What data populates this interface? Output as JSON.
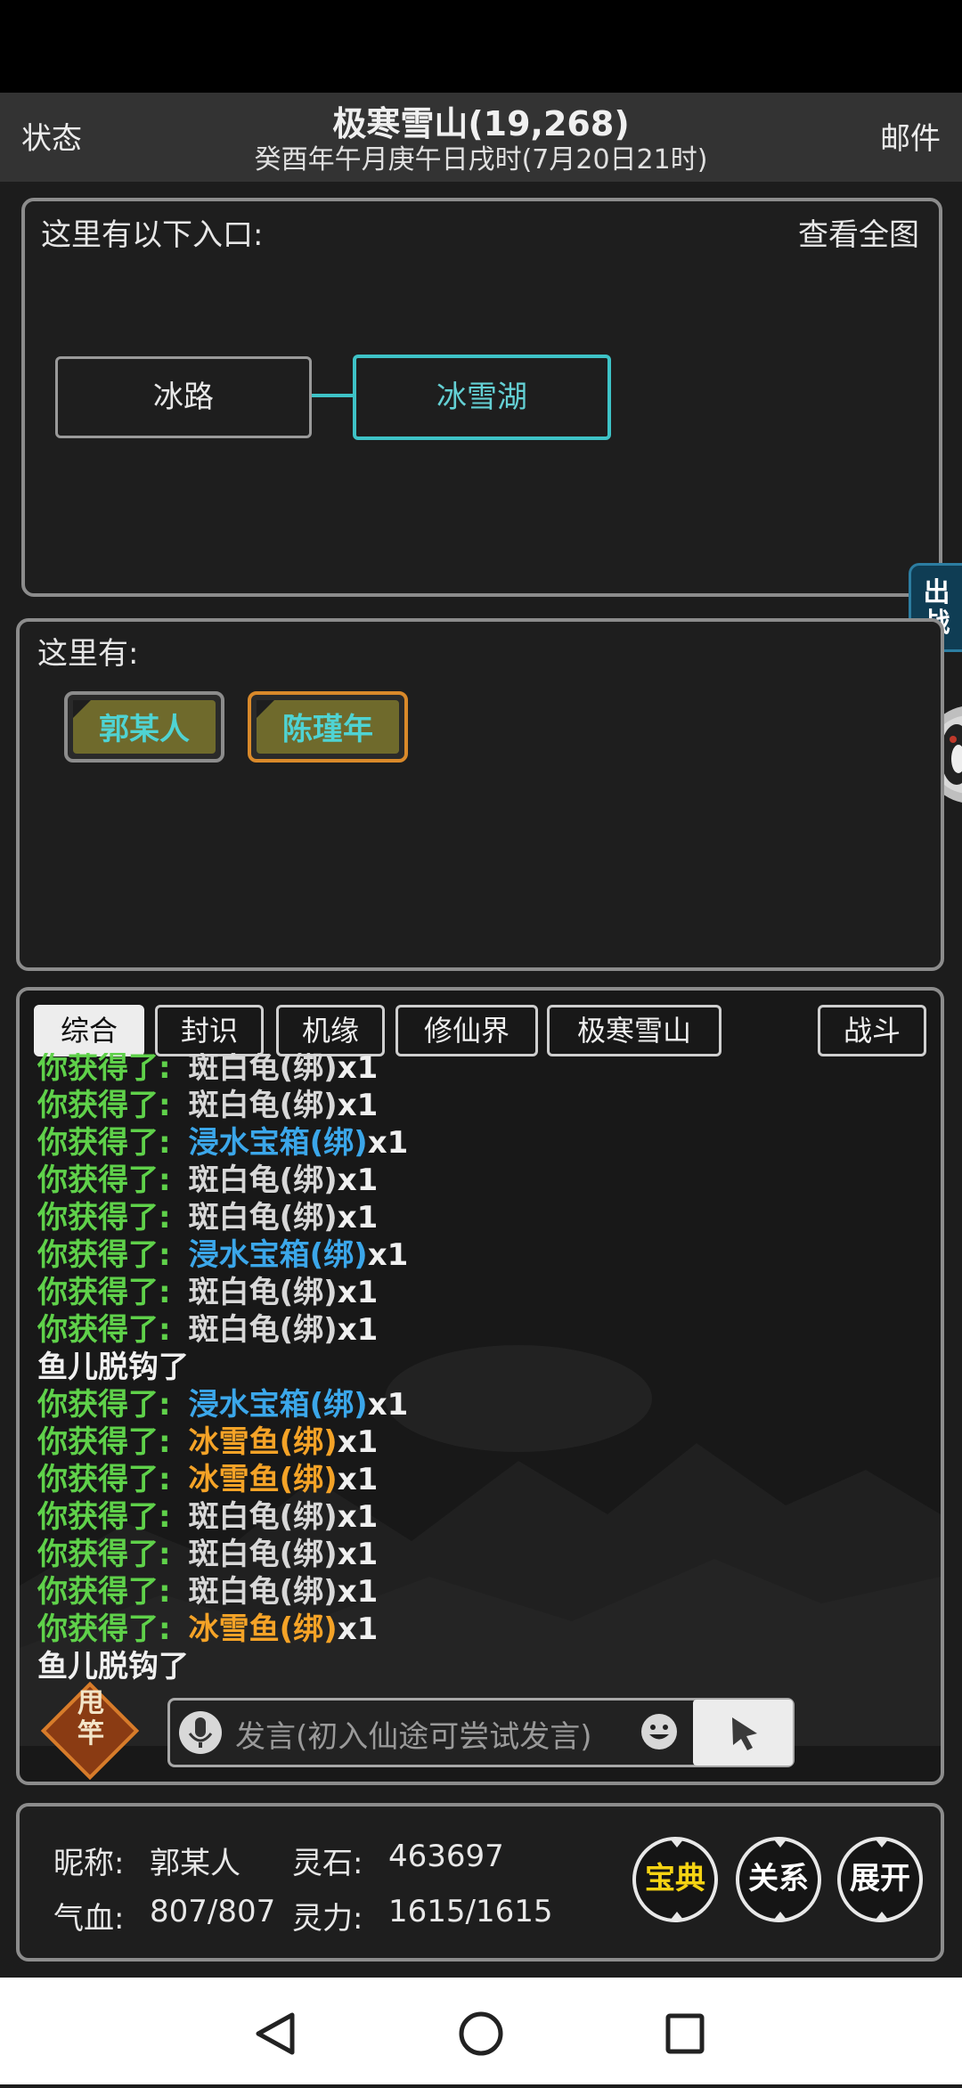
{
  "header": {
    "left_label": "状态",
    "right_label": "邮件",
    "title": "极寒雪山(19,268)",
    "subtitle": "癸酉年午月庚午日戌时(7月20日21时)"
  },
  "entrances": {
    "title": "这里有以下入口:",
    "map_link": "查看全图",
    "rooms": [
      "冰路",
      "冰雪湖"
    ]
  },
  "side_tab": {
    "label_top": "出",
    "label_bottom": "战"
  },
  "here": {
    "title": "这里有:",
    "npcs": [
      "郭某人",
      "陈瑾年"
    ]
  },
  "chat": {
    "tabs": [
      "综合",
      "封识",
      "机缘",
      "修仙界",
      "极寒雪山",
      "战斗"
    ],
    "active_tab": "综合",
    "log": [
      {
        "label": "你获得了:",
        "item": "斑白龟(绑)",
        "qty": "x1",
        "color": "#d8d8d8"
      },
      {
        "label": "你获得了:",
        "item": "斑白龟(绑)",
        "qty": "x1",
        "color": "#d8d8d8"
      },
      {
        "label": "你获得了:",
        "item": "浸水宝箱(绑)",
        "qty": "x1",
        "color": "#3ba7ea"
      },
      {
        "label": "你获得了:",
        "item": "斑白龟(绑)",
        "qty": "x1",
        "color": "#d8d8d8"
      },
      {
        "label": "你获得了:",
        "item": "斑白龟(绑)",
        "qty": "x1",
        "color": "#d8d8d8"
      },
      {
        "label": "你获得了:",
        "item": "浸水宝箱(绑)",
        "qty": "x1",
        "color": "#3ba7ea"
      },
      {
        "label": "你获得了:",
        "item": "斑白龟(绑)",
        "qty": "x1",
        "color": "#d8d8d8"
      },
      {
        "label": "你获得了:",
        "item": "斑白龟(绑)",
        "qty": "x1",
        "color": "#d8d8d8"
      },
      {
        "system": "鱼儿脱钩了"
      },
      {
        "label": "你获得了:",
        "item": "浸水宝箱(绑)",
        "qty": "x1",
        "color": "#3ba7ea"
      },
      {
        "label": "你获得了:",
        "item": "冰雪鱼(绑)",
        "qty": "x1",
        "color": "#f5a327"
      },
      {
        "label": "你获得了:",
        "item": "冰雪鱼(绑)",
        "qty": "x1",
        "color": "#f5a327"
      },
      {
        "label": "你获得了:",
        "item": "斑白龟(绑)",
        "qty": "x1",
        "color": "#d8d8d8"
      },
      {
        "label": "你获得了:",
        "item": "斑白龟(绑)",
        "qty": "x1",
        "color": "#d8d8d8"
      },
      {
        "label": "你获得了:",
        "item": "斑白龟(绑)",
        "qty": "x1",
        "color": "#d8d8d8"
      },
      {
        "label": "你获得了:",
        "item": "冰雪鱼(绑)",
        "qty": "x1",
        "color": "#f5a327"
      },
      {
        "system": "鱼儿脱钩了"
      }
    ],
    "rod_label_top": "甩",
    "rod_label_bottom": "竿",
    "input_placeholder": "发言(初入仙途可尝试发言)"
  },
  "stats": {
    "name_label": "昵称:",
    "name_value": "郭某人",
    "stone_label": "灵石:",
    "stone_value": "463697",
    "hp_label": "气血:",
    "hp_value": "807/807",
    "mp_label": "灵力:",
    "mp_value": "1615/1615",
    "buttons": [
      "宝典",
      "关系",
      "展开"
    ]
  },
  "colors": {
    "label_green": "#5fd14a",
    "accent_cyan": "#3ec3c7",
    "npc_border_orange": "#d9892a"
  },
  "icons": [
    "microphone-icon",
    "emoji-icon",
    "cursor-icon",
    "back-icon",
    "home-icon",
    "recents-icon"
  ]
}
